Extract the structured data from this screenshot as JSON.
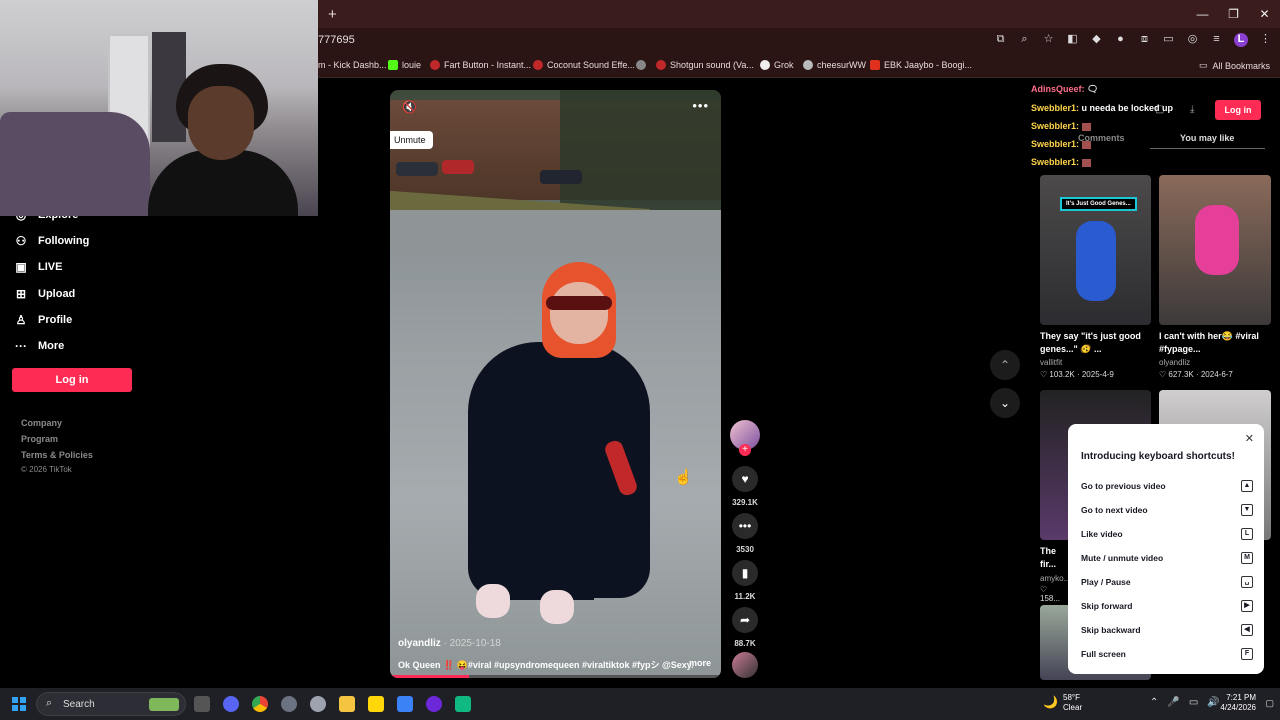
{
  "browser": {
    "new_tab": "+",
    "window_controls": [
      "—",
      "❐",
      "✕"
    ],
    "url_fragment": "777695",
    "profile_initial": "L",
    "bookmarks": [
      {
        "label": "m - Kick Dashb...",
        "color": "#2bd36a"
      },
      {
        "label": "louie",
        "color": "#53fc18"
      },
      {
        "label": "Fart Button - Instant...",
        "color": "#c0282a"
      },
      {
        "label": "Coconut Sound Effe...",
        "color": "#c0282a"
      },
      {
        "label": "",
        "color": "#888888"
      },
      {
        "label": "Shotgun sound (Va...",
        "color": "#c0282a"
      },
      {
        "label": "Grok",
        "color": "#eeeeee"
      },
      {
        "label": "cheesurWW",
        "color": "#bbbbbb"
      },
      {
        "label": "EBK Jaaybo - Boogi...",
        "color": "#e0301e"
      }
    ],
    "all_bookmarks": "All Bookmarks"
  },
  "nav": {
    "explore": "Explore",
    "following": "Following",
    "live": "LIVE",
    "upload": "Upload",
    "profile": "Profile",
    "more": "More",
    "login": "Log in",
    "footer": [
      "Company",
      "Program",
      "Terms & Policies"
    ],
    "copyright": "© 2026 TikTok"
  },
  "video": {
    "unmute_tooltip": "Unmute",
    "author": "olyandliz",
    "date": " · 2025-10-18",
    "caption": "Ok Queen ‼️ 😝#viral #upsyndromequeen #viraltiktok #fypシ @Sexy...",
    "more": "more",
    "progress": 0.24
  },
  "rail": {
    "likes": "329.1K",
    "comments": "3530",
    "saves": "11.2K",
    "shares": "88.7K"
  },
  "chat": [
    {
      "name": "AdinsQueef:",
      "msg": "",
      "first": true
    },
    {
      "name": "Swebbler1:",
      "msg": " u needa be locked up",
      "first": false
    },
    {
      "name": "Swebbler1:",
      "msg": "",
      "first": false
    },
    {
      "name": "Swebbler1:",
      "msg": "",
      "first": false
    },
    {
      "name": "Swebbler1:",
      "msg": "",
      "first": false
    }
  ],
  "right_panel": {
    "login": "Log in",
    "tabs": [
      "Comments",
      "You may like"
    ],
    "cards": [
      {
        "tag": "It's Just Good Genes...",
        "title": "They say \"it's just good genes...\" 🫨 ...",
        "author": "vallitfit",
        "stats": "♡ 103.2K · 2025-4-9"
      },
      {
        "tag": "",
        "title": "I can't with her😂 #viral #fypage...",
        "author": "olyandliz",
        "stats": "♡ 627.3K · 2024-6-7"
      },
      {
        "tag": "",
        "title": "The fir... Down",
        "author": "amyko...",
        "stats": "♡ 158..."
      }
    ]
  },
  "shortcuts": {
    "title": "Introducing keyboard shortcuts!",
    "close": "✕",
    "rows": [
      {
        "label": "Go to previous video",
        "key": "▲"
      },
      {
        "label": "Go to next video",
        "key": "▼"
      },
      {
        "label": "Like video",
        "key": "L"
      },
      {
        "label": "Mute / unmute video",
        "key": "M"
      },
      {
        "label": "Play / Pause",
        "key": "␣"
      },
      {
        "label": "Skip forward",
        "key": "▶"
      },
      {
        "label": "Skip backward",
        "key": "◀"
      },
      {
        "label": "Full screen",
        "key": "F"
      }
    ]
  },
  "taskbar": {
    "search": "Search",
    "temp": "58°F",
    "weather": "Clear",
    "time": "7:21 PM",
    "date": "4/24/2026"
  },
  "colors": {
    "accent": "#fe2c55",
    "chrome": "#3a1c1c"
  }
}
